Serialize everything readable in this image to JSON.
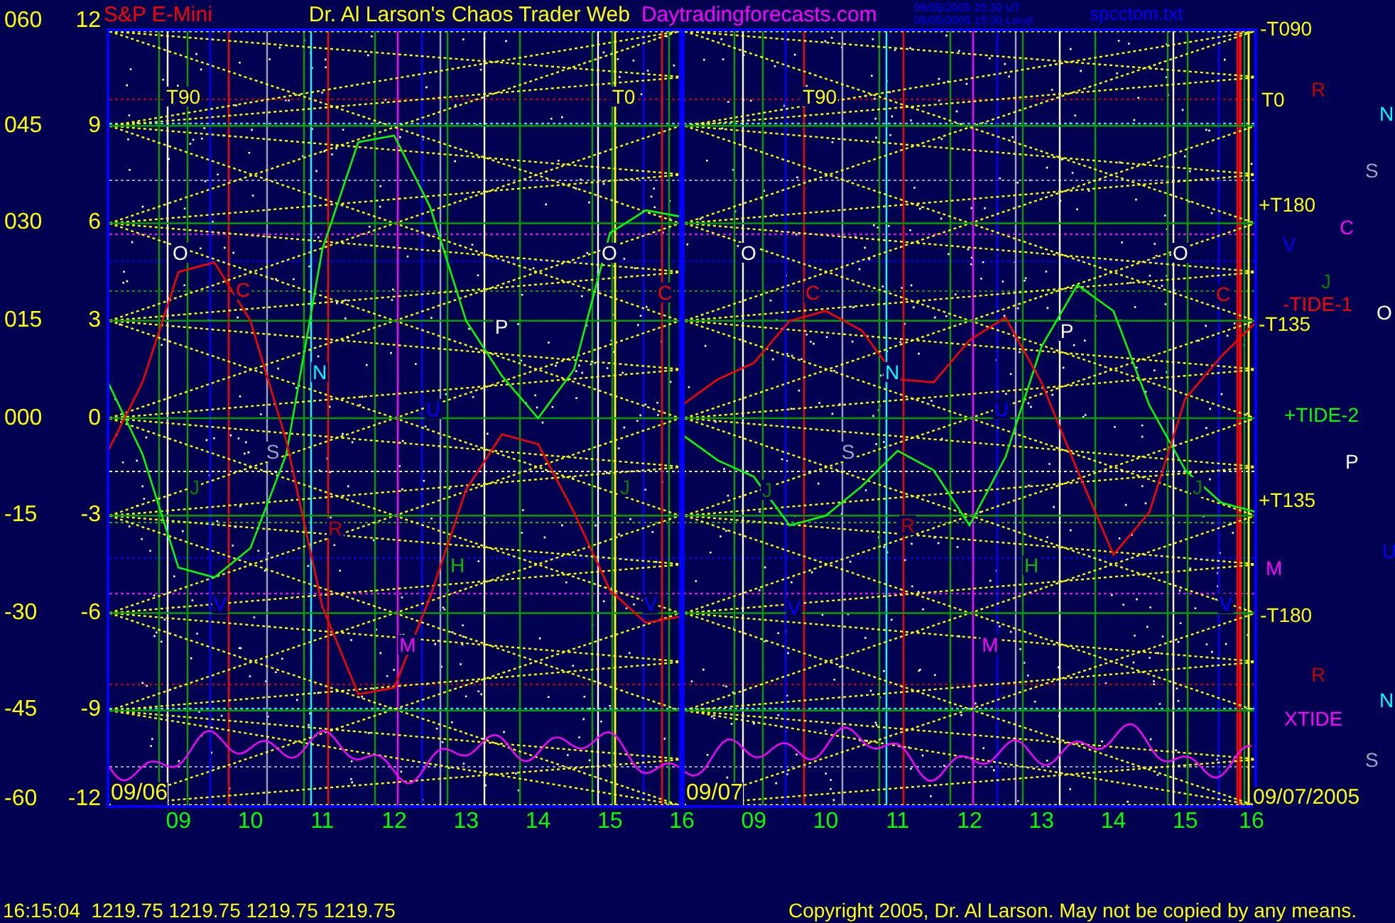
{
  "header": {
    "symbol": "S&P E-Mini",
    "site_title": "Dr. Al Larson's Chaos Trader Web",
    "site_url": "Daytradingforecasts.com",
    "timestamps": [
      "09/05/2005 20:30 UT",
      "09/05/2005 15:30 Local"
    ],
    "file": "spcctom.txt"
  },
  "y_axis_outer": [
    "060",
    "045",
    "030",
    "015",
    "000",
    "-15",
    "-30",
    "-45",
    "-60"
  ],
  "charts": [
    {
      "date": "09/06",
      "chart_data": {
        "type": "line",
        "grid": true,
        "xlim": [
          8,
          16
        ],
        "ylim": [
          -12,
          12
        ],
        "x": [
          8,
          8.5,
          9,
          9.5,
          10,
          10.5,
          11,
          11.5,
          12,
          12.5,
          13,
          13.5,
          14,
          14.5,
          15,
          15.5,
          16
        ],
        "xticks": [
          {
            "value": 9,
            "label": "09"
          },
          {
            "value": 10,
            "label": "10"
          },
          {
            "value": 11,
            "label": "11"
          },
          {
            "value": 12,
            "label": "12"
          },
          {
            "value": 13,
            "label": "13"
          },
          {
            "value": 14,
            "label": "14"
          },
          {
            "value": 15,
            "label": "15"
          },
          {
            "value": 16,
            "label": "16"
          }
        ],
        "yticks": [
          {
            "value": 12,
            "label": "12"
          },
          {
            "value": 9,
            "label": "9"
          },
          {
            "value": 6,
            "label": "6"
          },
          {
            "value": 3,
            "label": "3"
          },
          {
            "value": 0,
            "label": "0"
          },
          {
            "value": -3,
            "label": "-3"
          },
          {
            "value": -6,
            "label": "-6"
          },
          {
            "value": -9,
            "label": "-9"
          },
          {
            "value": -12,
            "label": "-12"
          }
        ],
        "series": [
          {
            "color": "#00ff00",
            "values": [
              1.2,
              -1.1,
              -4.6,
              -4.9,
              -4.0,
              -1.1,
              5.2,
              8.5,
              8.7,
              6.5,
              3.0,
              1.3,
              0.0,
              1.5,
              5.7,
              6.4,
              6.2
            ]
          },
          {
            "color": "#ff0000",
            "values": [
              -1.1,
              1.1,
              4.5,
              4.8,
              3.0,
              -0.7,
              -5.8,
              -8.5,
              -8.3,
              -5.5,
              -2.2,
              -0.5,
              -0.8,
              -2.9,
              -5.3,
              -6.3,
              -6.1
            ]
          }
        ]
      }
    },
    {
      "date": "09/07",
      "chart_data": {
        "type": "line",
        "grid": true,
        "xlim": [
          8,
          16
        ],
        "ylim": [
          -12,
          12
        ],
        "x": [
          8,
          8.5,
          9,
          9.5,
          10,
          10.5,
          11,
          11.5,
          12,
          12.5,
          13,
          13.5,
          14,
          14.5,
          15,
          15.5,
          16
        ],
        "xticks": [
          {
            "value": 9,
            "label": "09"
          },
          {
            "value": 10,
            "label": "10"
          },
          {
            "value": 11,
            "label": "11"
          },
          {
            "value": 12,
            "label": "12"
          },
          {
            "value": 13,
            "label": "13"
          },
          {
            "value": 14,
            "label": "14"
          },
          {
            "value": 15,
            "label": "15"
          },
          {
            "value": 16,
            "label": "16"
          }
        ],
        "series": [
          {
            "name": "+TIDE-2",
            "color": "#00ff00",
            "values": [
              -0.5,
              -1.3,
              -1.8,
              -3.3,
              -3.0,
              -2.1,
              -1.0,
              -1.6,
              -3.3,
              -1.2,
              2.2,
              4.1,
              3.3,
              0.4,
              -1.6,
              -2.6,
              -2.9
            ]
          },
          {
            "name": "-TIDE-1",
            "color": "#ff0000",
            "values": [
              0.4,
              1.2,
              1.7,
              3.0,
              3.3,
              2.7,
              1.2,
              1.1,
              2.4,
              3.1,
              1.1,
              -1.6,
              -4.2,
              -2.9,
              0.6,
              1.9,
              3.0
            ]
          }
        ]
      }
    }
  ],
  "end_date": "09/07/2005",
  "plot_labels": [
    {
      "text": "T90",
      "color": "#ffff00"
    },
    {
      "text": "T0",
      "color": "#ffff00"
    },
    {
      "text": "T90",
      "color": "#ffff00"
    },
    {
      "text": "O",
      "color": "#ffffff"
    },
    {
      "text": "C",
      "color": "#ff0000"
    },
    {
      "text": "N",
      "color": "#00ffff"
    },
    {
      "text": "S",
      "color": "#a0a0c0"
    },
    {
      "text": "J",
      "color": "#008000"
    },
    {
      "text": "V",
      "color": "#0000ff"
    },
    {
      "text": "R",
      "color": "#c00000"
    },
    {
      "text": "M",
      "color": "#ff00ff"
    },
    {
      "text": "U",
      "color": "#0000ff"
    },
    {
      "text": "H",
      "color": "#00c000"
    },
    {
      "text": "P",
      "color": "#ffffff"
    },
    {
      "text": "O",
      "color": "#ffffff"
    },
    {
      "text": "C",
      "color": "#ff0000"
    },
    {
      "text": "J",
      "color": "#008000"
    },
    {
      "text": "V",
      "color": "#0000ff"
    },
    {
      "text": "O",
      "color": "#ffffff"
    },
    {
      "text": "C",
      "color": "#ff0000"
    },
    {
      "text": "N",
      "color": "#00ffff"
    },
    {
      "text": "S",
      "color": "#a0a0c0"
    },
    {
      "text": "J",
      "color": "#008000"
    },
    {
      "text": "V",
      "color": "#0000ff"
    },
    {
      "text": "R",
      "color": "#c00000"
    },
    {
      "text": "M",
      "color": "#ff00ff"
    },
    {
      "text": "U",
      "color": "#0000ff"
    },
    {
      "text": "H",
      "color": "#00c000"
    },
    {
      "text": "P",
      "color": "#ffffff"
    },
    {
      "text": "O",
      "color": "#ffffff"
    },
    {
      "text": "J",
      "color": "#008000"
    },
    {
      "text": "V",
      "color": "#0000ff"
    },
    {
      "text": "C",
      "color": "#ff0000"
    }
  ],
  "right_labels": [
    {
      "text": "-T090",
      "color": "#ffff00"
    },
    {
      "text": "T0",
      "color": "#ffff00"
    },
    {
      "text": "R",
      "color": "#c00000"
    },
    {
      "text": "N",
      "color": "#00ffff"
    },
    {
      "text": "S",
      "color": "#a0a0c0"
    },
    {
      "text": "+T180",
      "color": "#ffff00"
    },
    {
      "text": "C",
      "color": "#ff00ff"
    },
    {
      "text": "V",
      "color": "#0000ff"
    },
    {
      "text": "J",
      "color": "#008000"
    },
    {
      "text": "O",
      "color": "#ffffff"
    },
    {
      "text": "-T135",
      "color": "#ffff00"
    },
    {
      "text": "P",
      "color": "#ffffff"
    },
    {
      "text": "+T135",
      "color": "#ffff00"
    },
    {
      "text": "U",
      "color": "#0000ff"
    },
    {
      "text": "M",
      "color": "#ff00ff"
    },
    {
      "text": "-T180",
      "color": "#ffff00"
    },
    {
      "text": "R",
      "color": "#c00000"
    },
    {
      "text": "N",
      "color": "#00ffff"
    },
    {
      "text": "XTIDE",
      "color": "#ff00ff"
    },
    {
      "text": "S",
      "color": "#a0a0c0"
    }
  ],
  "status_bar": {
    "quote": "16:15:04  1219.75 1219.75 1219.75 1219.75",
    "copyright": "Copyright 2005, Dr. Al Larson. May not be copied by any means."
  }
}
